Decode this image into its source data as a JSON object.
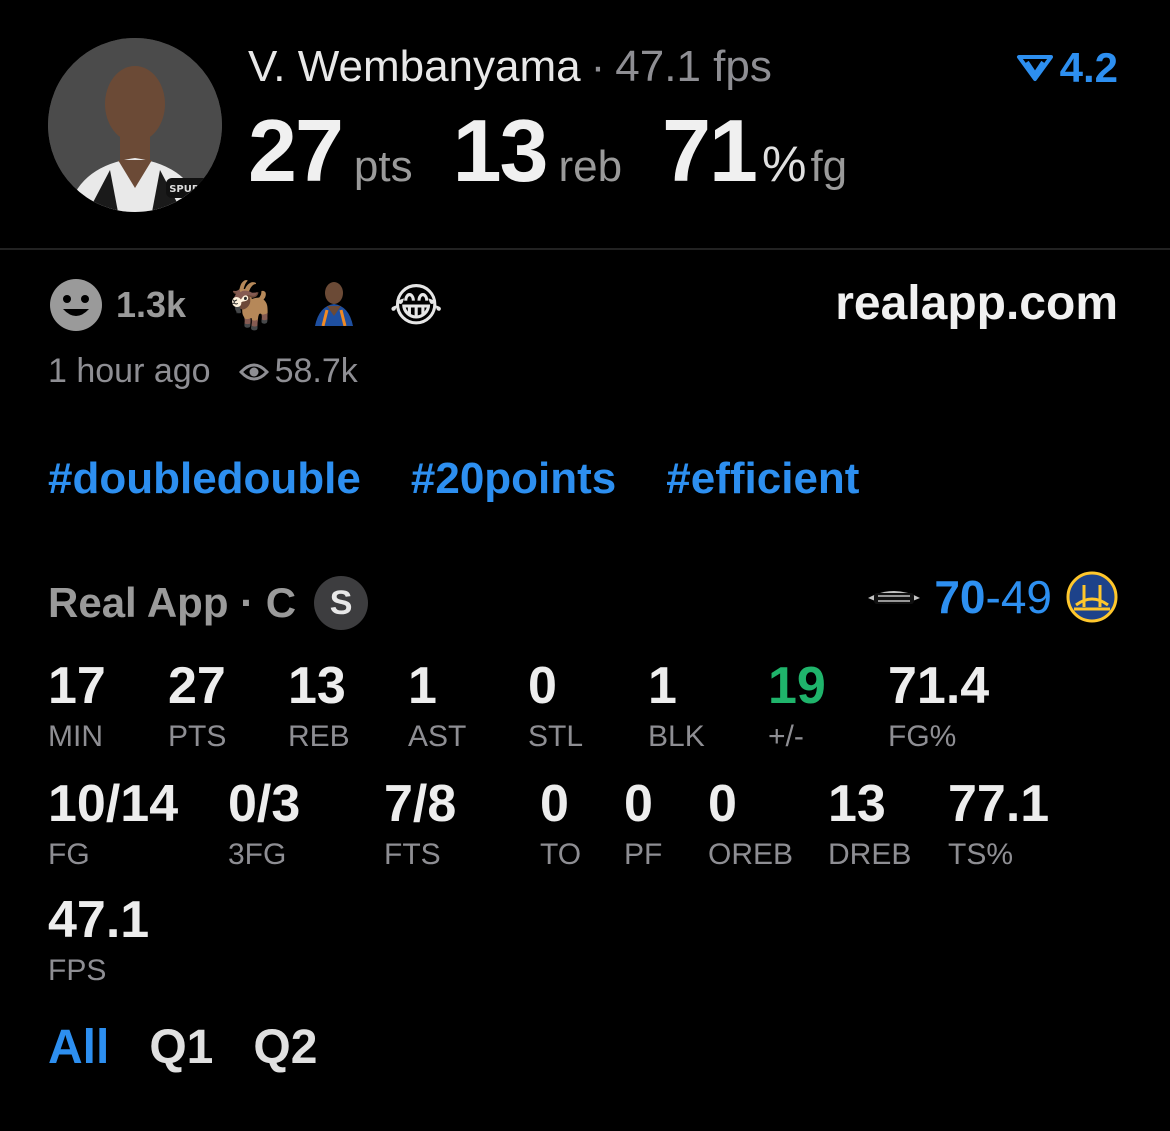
{
  "header": {
    "player_name": "V. Wembanyama",
    "separator": "·",
    "fps_text": "47.1 fps",
    "rating": "4.2",
    "pts": "27",
    "pts_unit": "pts",
    "reb": "13",
    "reb_unit": "reb",
    "fg": "71",
    "fg_pct": "%",
    "fg_unit": "fg",
    "avatar_logo_text": "SPURS"
  },
  "social": {
    "reaction_count": "1.3k",
    "reactions": [
      "🐐",
      "🏀",
      "😂"
    ],
    "site": "realapp.com",
    "time_ago": "1 hour ago",
    "views": "58.7k"
  },
  "tags": [
    "#doubledouble",
    "#20points",
    "#efficient"
  ],
  "game": {
    "source": "Real App · C",
    "badge": "S",
    "home_score": "70",
    "dash": "-",
    "away_score": "49"
  },
  "stats_row1": [
    {
      "value": "17",
      "label": "MIN"
    },
    {
      "value": "27",
      "label": "PTS"
    },
    {
      "value": "13",
      "label": "REB"
    },
    {
      "value": "1",
      "label": "AST"
    },
    {
      "value": "0",
      "label": "STL"
    },
    {
      "value": "1",
      "label": "BLK"
    },
    {
      "value": "19",
      "label": "+/-"
    },
    {
      "value": "71.4",
      "label": "FG%"
    }
  ],
  "stats_row2": [
    {
      "value": "10/14",
      "label": "FG"
    },
    {
      "value": "0/3",
      "label": "3FG"
    },
    {
      "value": "7/8",
      "label": "FTS"
    },
    {
      "value": "0",
      "label": "TO"
    },
    {
      "value": "0",
      "label": "PF"
    },
    {
      "value": "0",
      "label": "OREB"
    },
    {
      "value": "13",
      "label": "DREB"
    },
    {
      "value": "77.1",
      "label": "TS%"
    }
  ],
  "stats_row3": [
    {
      "value": "47.1",
      "label": "FPS"
    }
  ],
  "tabs": [
    "All",
    "Q1",
    "Q2"
  ],
  "colors": {
    "accent": "#2d8ff0",
    "positive": "#1fb46b",
    "muted": "#8e8e93"
  }
}
